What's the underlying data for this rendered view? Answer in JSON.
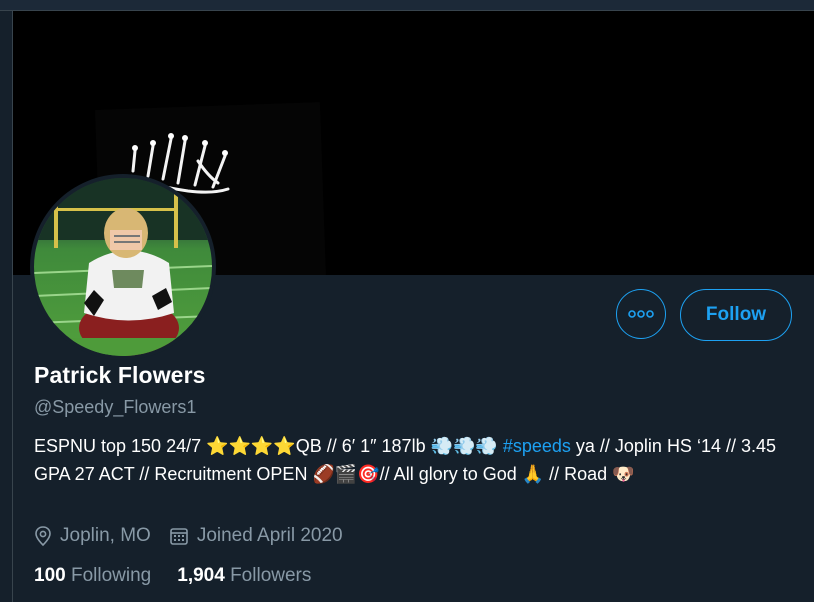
{
  "profile": {
    "display_name": "Patrick Flowers",
    "handle": "@Speedy_Flowers1",
    "bio": {
      "line1_before": "ESPNU top 150 24/7 ⭐⭐⭐⭐QB // 6′ 1″ 187lb 💨💨💨 ",
      "hashtag": "#speeds",
      "line1_after": " ya // Joplin HS ‘14 // 3.45 GPA 27 ACT // Recruitment OPEN 🏈🎬🎯// All glory to God 🙏 // Road 🐶"
    },
    "location": "Joplin, MO",
    "joined": "Joined April 2020",
    "following_count": "100",
    "following_label": "Following",
    "followers_count": "1,904",
    "followers_label": "Followers"
  },
  "actions": {
    "follow_label": "Follow",
    "more_icon": "more-dots-icon"
  },
  "icons": {
    "location": "location-pin-icon",
    "calendar": "calendar-icon"
  },
  "colors": {
    "background": "#15202b",
    "accent": "#1da1f2",
    "secondary_text": "#8899a6"
  }
}
